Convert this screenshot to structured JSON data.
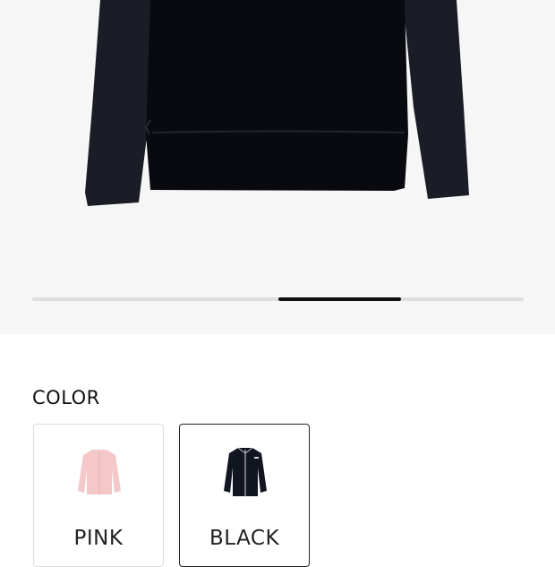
{
  "gallery": {
    "image_alt": "Black long-sleeve zip jacket",
    "slide_progress": {
      "start": 0.5,
      "end": 0.75
    }
  },
  "color_section": {
    "title": "COLOR",
    "options": [
      {
        "label": "PINK",
        "color": "#f4c7c8",
        "selected": false
      },
      {
        "label": "BLACK",
        "color": "#111520",
        "selected": true
      }
    ]
  }
}
